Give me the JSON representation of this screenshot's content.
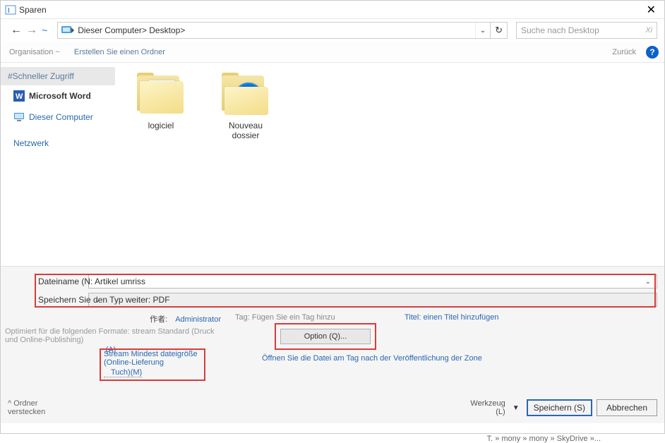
{
  "title": "Sparen",
  "nav": {
    "path": "Dieser Computer> Desktop>",
    "search_placeholder": "Suche nach Desktop",
    "search_icon": "Xi"
  },
  "toolbar": {
    "org": "Organisation ~",
    "newfolder": "Erstellen Sie einen Ordner",
    "back": "Zurück"
  },
  "sidebar": {
    "quick": "#Schneller Zugriff",
    "word": "Microsoft Word",
    "pc": "Dieser Computer",
    "net": "Netzwerk"
  },
  "folders": [
    {
      "label": "logiciel"
    },
    {
      "label": "Nouveau dossier"
    }
  ],
  "bottom": {
    "filename_full": "Dateiname (N: Artikel umriss",
    "savetype_full": "Speichern Sie den Typ weiter: PDF",
    "author_lbl": "作者:",
    "author_val": "Administrator",
    "tag": "Tag: Fügen Sie ein Tag hinzu",
    "title_hint": "Titel: einen Titel hinzufügen",
    "optimize": "Optimiert für die folgenden Formate: stream Standard (Druck und Online-Publishing)",
    "opt_a": "(A)",
    "option_btn": "Option (Q)...",
    "zone": "Öffnen Sie die Datei am Tag nach der Veröffentlichung der Zone",
    "stream1": "Stream Mindest dateigröße (Online-Lieferung",
    "stream2": "Tuch)(M)",
    "hide": "^ Ordner verstecken",
    "tools": "Werkzeug (L)",
    "save": "Speichern (S)",
    "cancel": "Abbrechen",
    "status": "T. » mony » mony » SkyDrive »..."
  }
}
